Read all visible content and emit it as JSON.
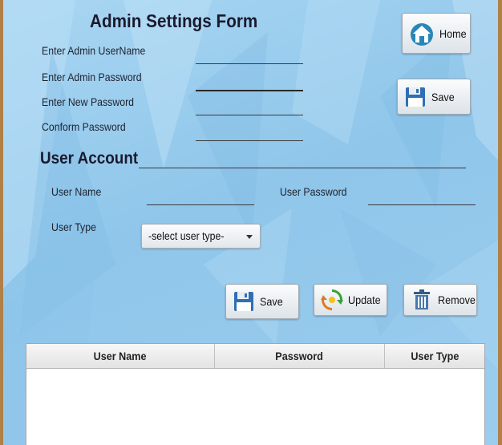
{
  "admin_form": {
    "title": "Admin Settings Form",
    "fields": {
      "username_label": "Enter Admin UserName",
      "password_label": "Enter Admin Password",
      "new_password_label": "Enter New Password",
      "confirm_password_label": "Conform Password"
    },
    "home_button": {
      "label": "Home",
      "icon": "home-icon"
    },
    "save_button": {
      "label": "Save",
      "icon": "floppy-disk-icon"
    }
  },
  "user_account": {
    "title": "User Account",
    "user_name_label": "User Name",
    "user_password_label": "User Password",
    "user_type_label": "User Type",
    "user_type_select": {
      "selected": "-select user type-"
    },
    "buttons": {
      "save": {
        "label": "Save",
        "icon": "floppy-disk-icon"
      },
      "update": {
        "label": "Update",
        "icon": "refresh-icon"
      },
      "remove": {
        "label": "Remove",
        "icon": "trash-icon"
      }
    }
  },
  "table": {
    "columns": [
      "User Name",
      "Password",
      "User Type"
    ],
    "rows": []
  },
  "colors": {
    "panel_background": "#9ccdee",
    "frame_border": "#b08048"
  }
}
